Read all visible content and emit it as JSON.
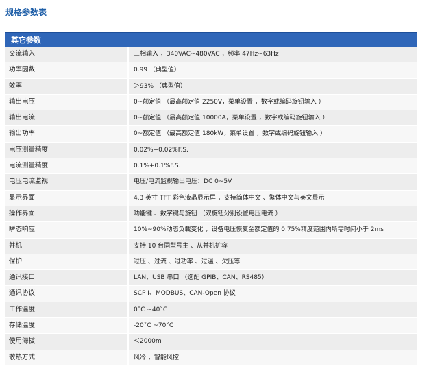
{
  "page": {
    "title": "规格参数表"
  },
  "section": {
    "title": "其它参数"
  },
  "rows": [
    {
      "name": "交流输入",
      "value": "三相输入 ，340VAC~480VAC ，频率 47Hz~63Hz"
    },
    {
      "name": "功率因数",
      "value": "0.99 （典型值）"
    },
    {
      "name": "效率",
      "value": "＞93% （典型值）"
    },
    {
      "name": "输出电压",
      "value": "0~额定值 （最高额定值 2250V，菜单设置 ，数字或编码旋钮输入 ）"
    },
    {
      "name": "输出电流",
      "value": "0~额定值 （最高额定值 10000A，菜单设置 ，数字或编码旋钮输入 ）"
    },
    {
      "name": "输出功率",
      "value": "0~额定值 （最高额定值 180kW，菜单设置 ，数字或编码旋钮输入 ）"
    },
    {
      "name": "电压测量精度",
      "value": "0.02%+0.02%F.S."
    },
    {
      "name": "电流测量精度",
      "value": "0.1%+0.1%F.S."
    },
    {
      "name": "电压电流监视",
      "value": "电压/电流监视输出电压：DC 0~5V"
    },
    {
      "name": "显示界面",
      "value": "4.3 英寸 TFT 彩色液晶显示屏 ，支持简体中文 、繁体中文与英文显示"
    },
    {
      "name": "操作界面",
      "value": "功能键 、数字键与旋钮 （双旋钮分别设置电压电流 ）"
    },
    {
      "name": "瞬态响应",
      "value": "10%~90%动态负载变化 ，设备电压恢复至额定值的 0.75%精度范围内所需时间小于 2ms"
    },
    {
      "name": "并机",
      "value": "支持 10 台同型号主 、从并机扩容"
    },
    {
      "name": "保护",
      "value": "过压 、过流 、过功率 、过温 、欠压等"
    },
    {
      "name": "通讯接口",
      "value": "LAN、USB 串口 （选配 GPIB、CAN、RS485）"
    },
    {
      "name": "通讯协议",
      "value": "SCP I、MODBUS、CAN-Open 协议"
    },
    {
      "name": "工作温度",
      "value": "0˚C ~40˚C"
    },
    {
      "name": "存储温度",
      "value": "-20˚C ~70˚C"
    },
    {
      "name": "使用海拔",
      "value": "＜2000m"
    },
    {
      "name": "散热方式",
      "value": "风冷 ，智能风控"
    }
  ]
}
